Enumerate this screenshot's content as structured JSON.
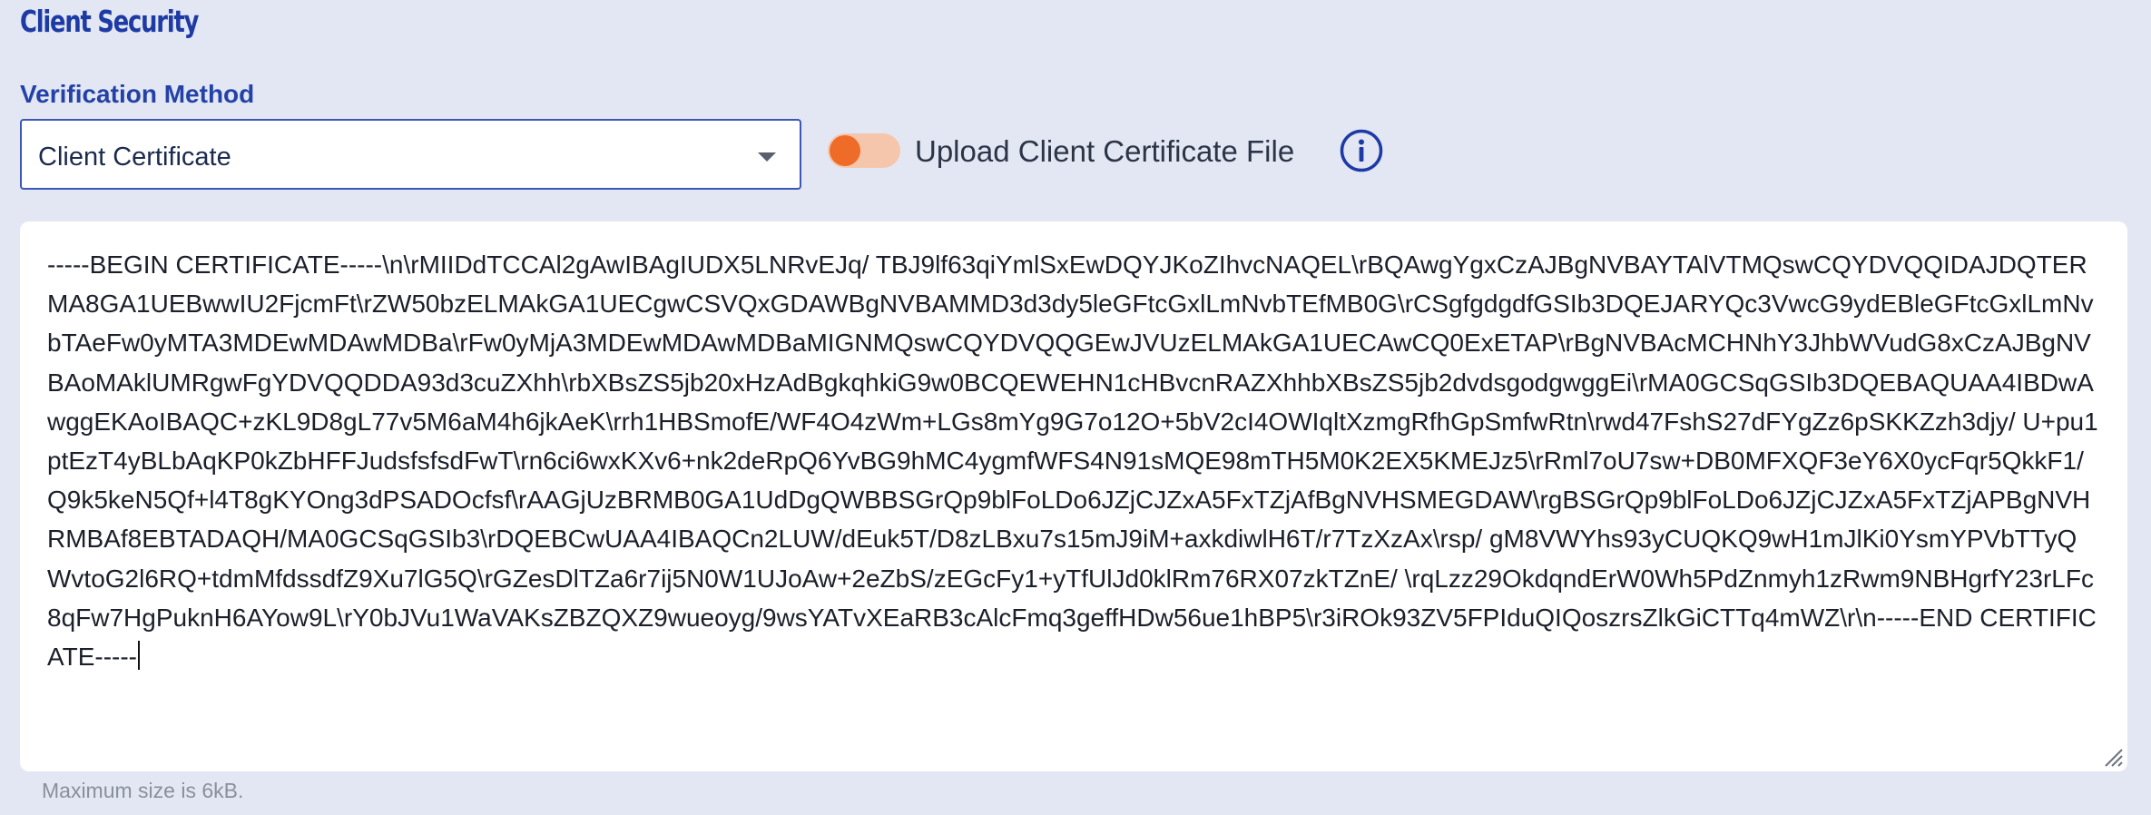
{
  "section": {
    "title": "Client Security"
  },
  "verification": {
    "label": "Verification Method",
    "selected_value": "Client Certificate",
    "dropdown_icon": "chevron-down-icon"
  },
  "upload_toggle": {
    "label": "Upload Client Certificate File",
    "state": "off",
    "accent_color": "#ef6c28"
  },
  "info": {
    "icon": "info-circle-icon",
    "color": "#1d3aa5"
  },
  "certificate": {
    "value": "-----BEGIN CERTIFICATE-----\\n\\rMIIDdTCCAl2gAwIBAgIUDX5LNRvEJq/ TBJ9lf63qiYmlSxEwDQYJKoZIhvcNAQEL\\rBQAwgYgxCzAJBgNVBAYTAlVTMQswCQYDVQQIDAJDQTERMA8GA1UEBwwIU2FjcmFt\\rZW50bzELMAkGA1UECgwCSVQxGDAWBgNVBAMMD3d3dy5leGFtcGxlLmNvbTEfMB0G\\rCSgfgdgdfGSIb3DQEJARYQc3VwcG9ydEBleGFtcGxlLmNvbTAeFw0yMTA3MDEwMDAwMDBa\\rFw0yMjA3MDEwMDAwMDBaMIGNMQswCQYDVQQGEwJVUzELMAkGA1UECAwCQ0ExETAP\\rBgNVBAcMCHNhY3JhbWVudG8xCzAJBgNVBAoMAklUMRgwFgYDVQQDDA93d3cuZXhh\\rbXBsZS5jb20xHzAdBgkqhkiG9w0BCQEWEHN1cHBvcnRAZXhhbXBsZS5jb2dvdsgodgwggEi\\rMA0GCSqGSIb3DQEBAQUAA4IBDwAwggEKAoIBAQC+zKL9D8gL77v5M6aM4h6jkAeK\\rrh1HBSmofE/WF4O4zWm+LGs8mYg9G7o12O+5bV2cI4OWIqltXzmgRfhGpSmfwRtn\\rwd47FshS27dFYgZz6pSKKZzh3djy/ U+pu1ptEzT4yBLbAqKP0kZbHFFJudsfsfsdFwT\\rn6ci6wxKXv6+nk2deRpQ6YvBG9hMC4ygmfWFS4N91sMQE98mTH5M0K2EX5KMEJz5\\rRml7oU7sw+DB0MFXQF3eY6X0ycFqr5QkkF1/ Q9k5keN5Qf+l4T8gKYOng3dPSADOcfsf\\rAAGjUzBRMB0GA1UdDgQWBBSGrQp9blFoLDo6JZjCJZxA5FxTZjAfBgNVHSMEGDAW\\rgBSGrQp9blFoLDo6JZjCJZxA5FxTZjAPBgNVHRMBAf8EBTADAQH/MA0GCSqGSIb3\\rDQEBCwUAA4IBAQCn2LUW/dEuk5T/D8zLBxu7s15mJ9iM+axkdiwlH6T/r7TzXzAx\\rsp/ gM8VWYhs93yCUQKQ9wH1mJlKi0YsmYPVbTTyQWvtoG2l6RQ+tdmMfdssdfZ9Xu7lG5Q\\rGZesDlTZa6r7ij5N0W1UJoAw+2eZbS/zEGcFy1+yTfUlJd0klRm76RX07zkTZnE/ \\rqLzz29OkdqndErW0Wh5PdZnmyh1zRwm9NBHgrfY23rLFc8qFw7HgPuknH6AYow9L\\rY0bJVu1WaVAKsZBZQXZ9wueoyg/9wsYATvXEaRB3cAlcFmq3geffHDw56ue1hBP5\\r3iROk93ZV5FPIduQIQoszrsZlkGiCTTq4mWZ\\r\\n-----END CERTIFICATE-----",
    "hint": "Maximum size is 6kB."
  }
}
